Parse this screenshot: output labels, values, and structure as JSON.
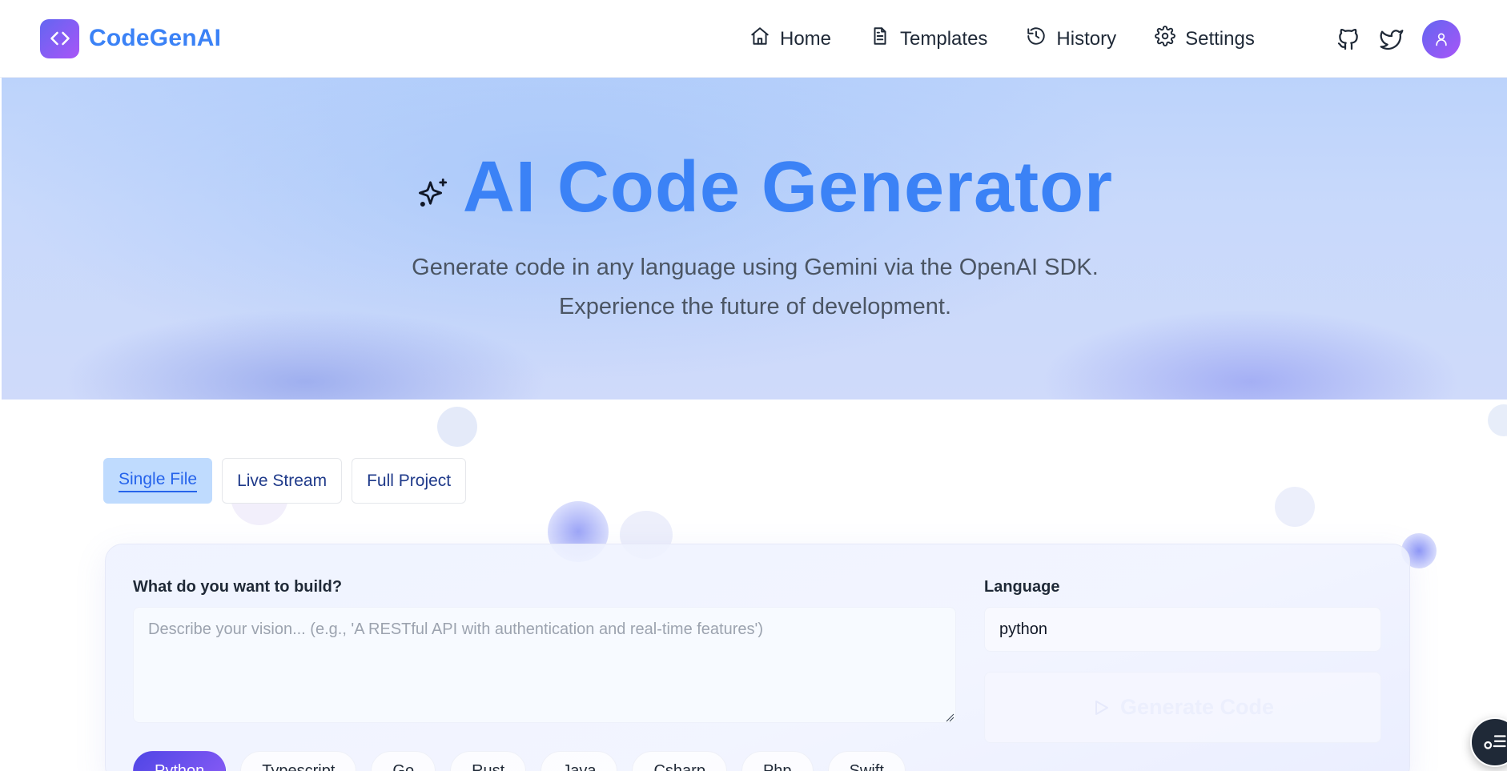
{
  "brand": {
    "name": "CodeGenAI"
  },
  "nav": {
    "items": [
      {
        "label": "Home",
        "icon": "home-icon"
      },
      {
        "label": "Templates",
        "icon": "document-icon"
      },
      {
        "label": "History",
        "icon": "history-icon"
      },
      {
        "label": "Settings",
        "icon": "gear-icon"
      }
    ]
  },
  "header_actions": [
    "github-icon",
    "twitter-icon",
    "user-avatar"
  ],
  "hero": {
    "title": "AI Code Generator",
    "subtitle_line1": "Generate code in any language using Gemini via the OpenAI SDK.",
    "subtitle_line2": "Experience the future of development."
  },
  "tabs": [
    {
      "label": "Single File",
      "active": true
    },
    {
      "label": "Live Stream",
      "active": false
    },
    {
      "label": "Full Project",
      "active": false
    }
  ],
  "form": {
    "prompt_label": "What do you want to build?",
    "prompt_placeholder": "Describe your vision... (e.g., 'A RESTful API with authentication and real-time features')",
    "prompt_value": "",
    "language_label": "Language",
    "language_value": "python",
    "generate_label": "Generate Code"
  },
  "language_chips": [
    {
      "label": "Python",
      "active": true
    },
    {
      "label": "Typescript",
      "active": false
    },
    {
      "label": "Go",
      "active": false
    },
    {
      "label": "Rust",
      "active": false
    },
    {
      "label": "Java",
      "active": false
    },
    {
      "label": "Csharp",
      "active": false
    },
    {
      "label": "Php",
      "active": false
    },
    {
      "label": "Swift",
      "active": false
    }
  ],
  "colors": {
    "accent": "#3b82f6",
    "brand_gradient_start": "#6366f1",
    "brand_gradient_end": "#a855f7"
  }
}
